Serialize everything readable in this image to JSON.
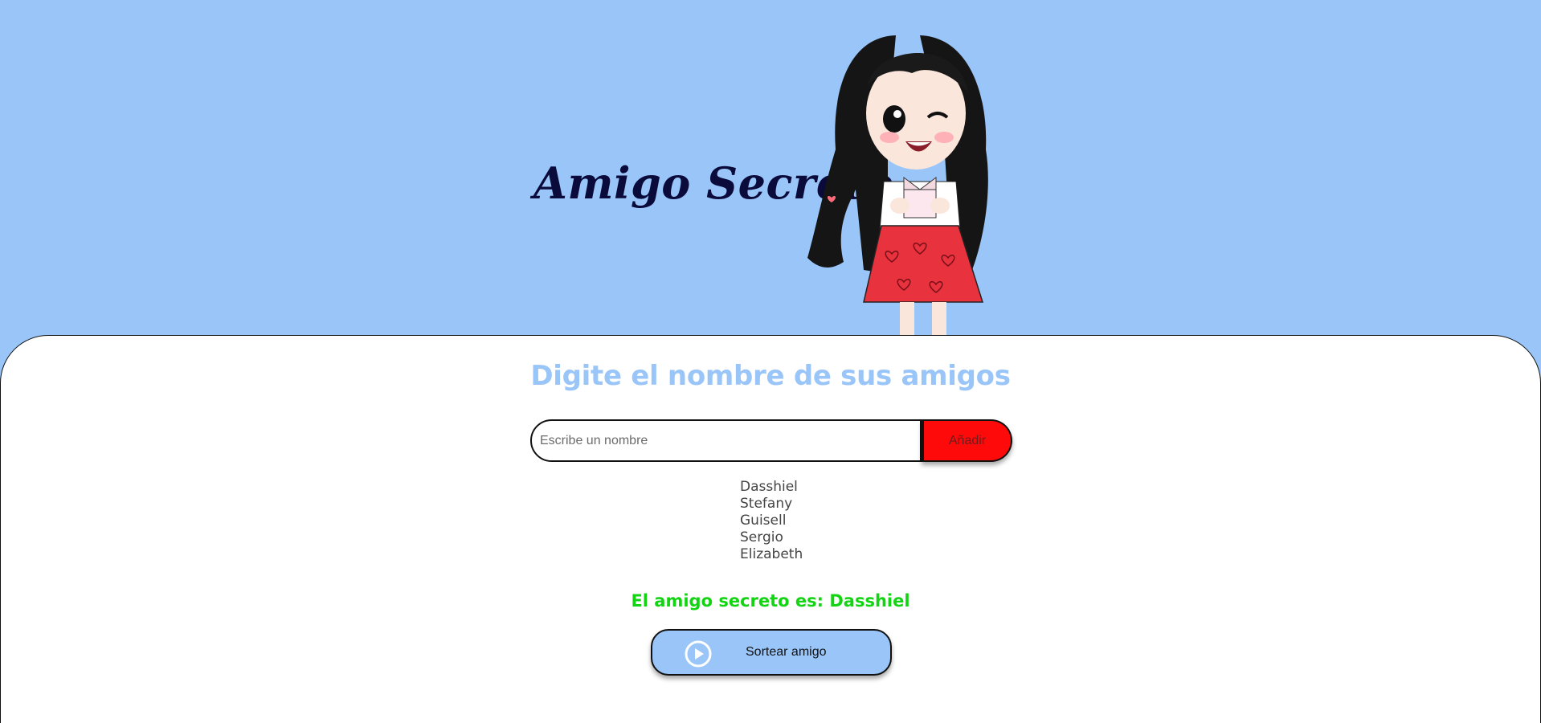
{
  "header": {
    "title": "Amigo Secreto",
    "mascot_icon": "girl-with-gift-icon"
  },
  "main": {
    "subtitle": "Digite el nombre de sus amigos",
    "input": {
      "placeholder": "Escribe un nombre",
      "value": ""
    },
    "add_button_label": "Añadir",
    "friends": [
      "Dasshiel",
      "Stefany",
      "Guisell",
      "Sergio",
      "Elizabeth"
    ],
    "result_text": "El amigo secreto es: Dasshiel",
    "draw_button_label": "Sortear amigo",
    "draw_button_icon": "play-circle-icon"
  },
  "colors": {
    "background": "#99c5f8",
    "accent_red": "#ff0a0a",
    "result_green": "#13d413",
    "title_navy": "#0b0b3b"
  }
}
